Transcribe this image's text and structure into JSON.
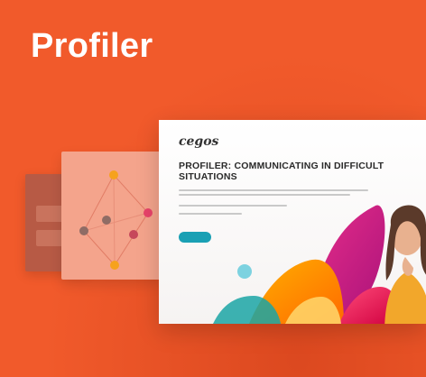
{
  "page": {
    "title": "Profiler"
  },
  "back_card": {
    "text": "",
    "option_1": "",
    "option_2": ""
  },
  "mid_card": {
    "label_top": "",
    "label_bottom": ""
  },
  "main_card": {
    "logo": "cegos",
    "headline": "PROFILER: COMMUNICATING IN DIFFICULT SITUATIONS",
    "button_label": ""
  },
  "colors": {
    "background": "#f15a2b",
    "mid_card": "#f4a48c",
    "accent_teal": "#1aa0b4",
    "accent_magenta": "#d81b60",
    "accent_orange": "#f7a21b"
  }
}
